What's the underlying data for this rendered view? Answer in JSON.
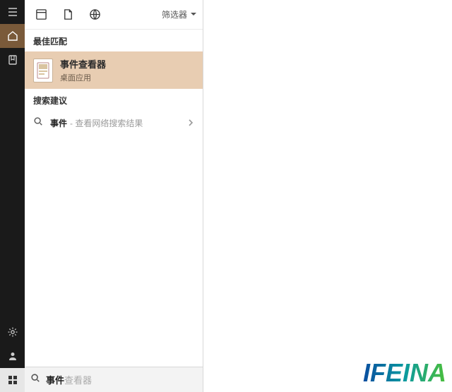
{
  "filter_label": "筛选器",
  "sections": {
    "best_match": "最佳匹配",
    "suggestions": "搜索建议"
  },
  "best_match": {
    "title": "事件查看器",
    "subtitle": "桌面应用"
  },
  "suggestion": {
    "bold": "事件",
    "dim": " - 查看网络搜索结果"
  },
  "search": {
    "typed": "事件",
    "ghost": "查看器"
  },
  "watermark": "IFEINA"
}
